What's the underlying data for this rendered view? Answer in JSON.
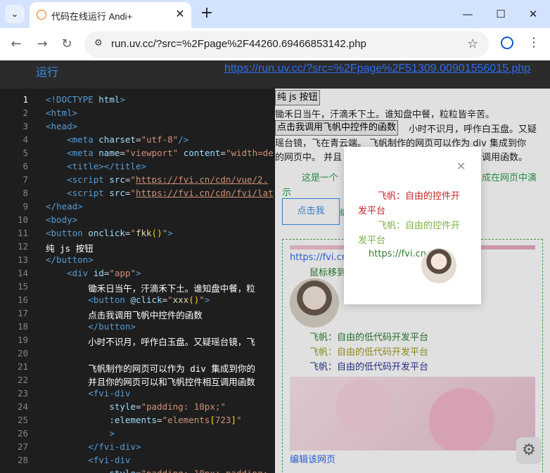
{
  "browser": {
    "tab_title": "代码在线运行 Andi+",
    "url": "run.uv.cc/?src=%2Fpage%2F44260.69466853142.php"
  },
  "page": {
    "run_label": "运行",
    "header_url": "https://run.uv.cc/?src=%2Fpage%2F51309.00901556015.php"
  },
  "editor": {
    "line_numbers": [
      "1",
      "2",
      "3",
      "4",
      "5",
      "6",
      "7",
      "8",
      "9",
      "10",
      "11",
      "12",
      "13",
      "14",
      "15",
      "16",
      "17",
      "18",
      "19",
      "20",
      "21",
      "22",
      "23",
      "24",
      "25",
      "26",
      "27",
      "28"
    ]
  },
  "preview": {
    "js_button_label": "纯 js 按钮",
    "poem_line1": "锄禾日当午，汗滴禾下土。谁知盘中餐，粒粒皆辛苦。",
    "call_button_label": "点击我调用飞帆中控件的函数",
    "text_after_button": "小时不识月，呼作白玉盘。又疑",
    "line_wrap1": "瑶台镜，飞在青云端。 飞帆制作的网页可以作为 div 集成到你",
    "line_wrap2": "的网页中。 并且",
    "line_wrap2b": "调用函数。",
    "green_intro_a": "这是一个",
    "green_intro_b": "成在网页中演",
    "green_intro_c": "示",
    "vue_button_label": "点击我",
    "vue_after": "编",
    "fvi_link": "https://fvi.cn",
    "hover_text": "鼠标移到",
    "fvi_lines": [
      {
        "text": "飞帆：自由的低代码开发平台",
        "color": "#2e7d32"
      },
      {
        "text": "飞帆：自由的低代码开发平台",
        "color": "#9e9d24"
      },
      {
        "text": "飞帆：自由的低代码开发平台",
        "color": "#283593"
      },
      {
        "text": "飞帆：自由的低代码开发平台",
        "color": "#c62828"
      }
    ],
    "edit_link": "编辑该网页"
  },
  "popup": {
    "line1a": "飞帆：自由的控件开",
    "line1b": "发平台",
    "line2a": "飞帆：自由的控件开",
    "line2b": "发平台",
    "link": "https://fvi.cn"
  }
}
